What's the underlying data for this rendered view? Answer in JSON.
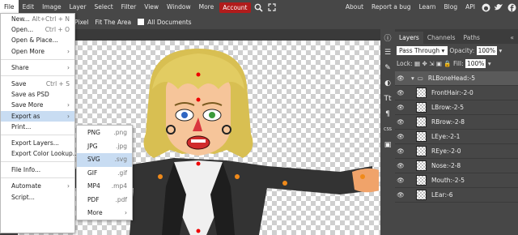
{
  "menubar": {
    "items": [
      "File",
      "Edit",
      "Image",
      "Layer",
      "Select",
      "Filter",
      "View",
      "Window",
      "More",
      "Account"
    ],
    "right": [
      "About",
      "Report a bug",
      "Learn",
      "Blog",
      "API"
    ]
  },
  "toolbar": {
    "pixel_label": "Pixel",
    "fit_label": "Fit The Area",
    "all_docs_label": "All Documents"
  },
  "file_menu": [
    {
      "label": "New...",
      "shortcut": "Alt+Ctrl + N"
    },
    {
      "label": "Open...",
      "shortcut": "Ctrl + O"
    },
    {
      "label": "Open & Place..."
    },
    {
      "label": "Open More",
      "arrow": true
    },
    {
      "sep": true
    },
    {
      "label": "Share",
      "arrow": true
    },
    {
      "sep": true
    },
    {
      "label": "Save",
      "shortcut": "Ctrl + S"
    },
    {
      "label": "Save as PSD"
    },
    {
      "label": "Save More",
      "arrow": true
    },
    {
      "label": "Export as",
      "arrow": true,
      "highlight": true
    },
    {
      "label": "Print..."
    },
    {
      "sep": true
    },
    {
      "label": "Export Layers..."
    },
    {
      "label": "Export Color Lookup..."
    },
    {
      "sep": true
    },
    {
      "label": "File Info..."
    },
    {
      "sep": true
    },
    {
      "label": "Automate",
      "arrow": true
    },
    {
      "label": "Script..."
    }
  ],
  "export_menu": [
    {
      "label": "PNG",
      "ext": ".png"
    },
    {
      "label": "JPG",
      "ext": ".jpg"
    },
    {
      "label": "SVG",
      "ext": ".svg",
      "highlight": true
    },
    {
      "label": "GIF",
      "ext": ".gif"
    },
    {
      "label": "MP4",
      "ext": ".mp4"
    },
    {
      "label": "PDF",
      "ext": ".pdf"
    },
    {
      "label": "More",
      "arrow": true
    }
  ],
  "layers_panel": {
    "tabs": [
      "Layers",
      "Channels",
      "Paths"
    ],
    "blend_mode": "Pass Through",
    "opacity_label": "Opacity:",
    "opacity": "100%",
    "lock_label": "Lock:",
    "fill_label": "Fill:",
    "fill": "100%",
    "group_name": "RLBoneHead:-5",
    "layers": [
      "FrontHair:-2-0",
      "LBrow:-2-5",
      "RBrow:-2-8",
      "LEye:-2-1",
      "REye:-2-0",
      "Nose:-2-8",
      "Mouth:-2-5",
      "LEar:-6"
    ]
  },
  "icons": [
    "search-icon",
    "fullscreen-icon",
    "reddit-icon",
    "twitter-icon",
    "facebook-icon"
  ],
  "colors": {
    "accent": "#b01b1b",
    "panel": "#474747",
    "highlight": "#c8dcf2"
  }
}
